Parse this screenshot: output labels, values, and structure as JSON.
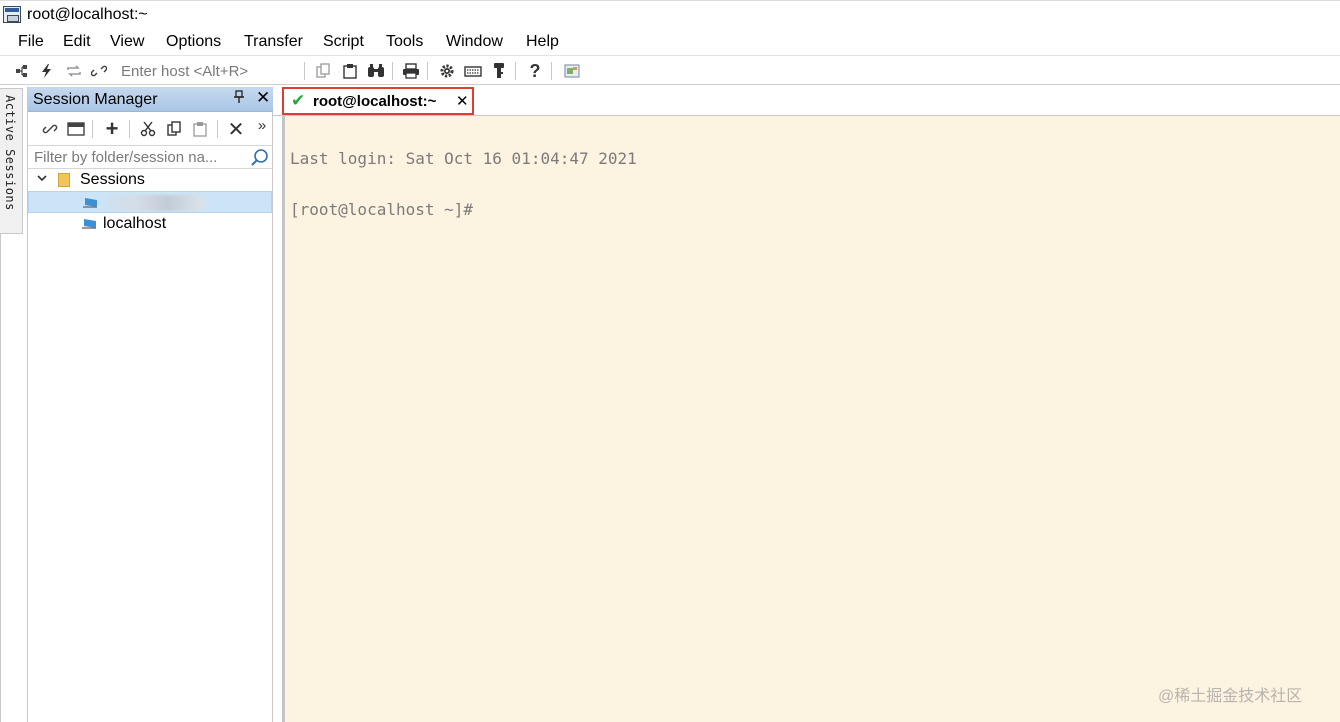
{
  "window": {
    "title": "root@localhost:~"
  },
  "menu": [
    "File",
    "Edit",
    "View",
    "Options",
    "Transfer",
    "Script",
    "Tools",
    "Window",
    "Help"
  ],
  "toolbar": {
    "host_placeholder": "Enter host <Alt+R>",
    "icons": [
      "connect-icon",
      "quick-connect-icon",
      "reconnect-icon",
      "disconnect-icon",
      "copy-icon",
      "paste-icon",
      "find-icon",
      "print-icon",
      "settings-icon",
      "keymap-icon",
      "key-icon",
      "help-icon",
      "screenshot-icon"
    ]
  },
  "active_sessions_tab": {
    "label": "Active Sessions"
  },
  "session_manager": {
    "title": "Session Manager",
    "filter_placeholder": "Filter by folder/session na...",
    "tree": {
      "folder": "Sessions",
      "items": [
        {
          "label": "",
          "redacted": true,
          "selected": true
        },
        {
          "label": "localhost",
          "selected": false
        }
      ]
    }
  },
  "tab": {
    "label": "root@localhost:~",
    "status": "connected"
  },
  "terminal": {
    "lines": [
      "Last login: Sat Oct 16 01:04:47 2021",
      "[root@localhost ~]#"
    ],
    "background": "#fdf3e1",
    "foreground": "#7b7b7b"
  },
  "watermark": "@稀土掘金技术社区",
  "colors": {
    "tab_highlight": "#e03c31",
    "check": "#27a836",
    "panel_header": "#b8d0ec",
    "selection": "#cce4f7"
  }
}
